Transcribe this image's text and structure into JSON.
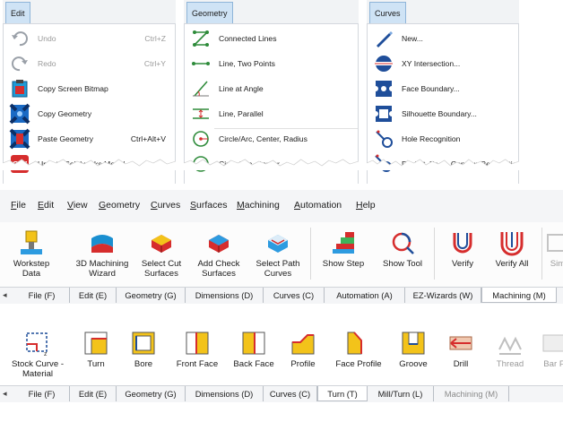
{
  "menus": [
    {
      "tab": "Edit",
      "items": [
        {
          "label": "Undo",
          "shortcut": "Ctrl+Z",
          "disabled": true,
          "icon": "undo-icon"
        },
        {
          "label": "Redo",
          "shortcut": "Ctrl+Y",
          "disabled": true,
          "icon": "redo-icon"
        },
        {
          "label": "Copy Screen Bitmap",
          "shortcut": "",
          "disabled": false,
          "icon": "copy-screen-bitmap-icon"
        },
        {
          "label": "Copy Geometry",
          "shortcut": "",
          "disabled": false,
          "icon": "copy-geometry-icon"
        },
        {
          "label": "Paste Geometry",
          "shortcut": "Ctrl+Alt+V",
          "disabled": false,
          "icon": "paste-geometry-icon"
        },
        {
          "label": "Update Solidworks Model",
          "shortcut": "",
          "disabled": false,
          "icon": "solidworks-icon"
        }
      ]
    },
    {
      "tab": "Geometry",
      "items": [
        {
          "label": "Connected Lines",
          "icon": "connected-lines-icon"
        },
        {
          "label": "Line, Two Points",
          "icon": "line-two-points-icon"
        },
        {
          "label": "Line at Angle",
          "icon": "line-at-angle-icon"
        },
        {
          "label": "Line, Parallel",
          "icon": "line-parallel-icon"
        },
        {
          "label": "Circle/Arc, Center, Radius",
          "icon": "circle-center-radius-icon"
        },
        {
          "label": "Circle/Arc, Center",
          "icon": "circle-center-icon"
        }
      ]
    },
    {
      "tab": "Curves",
      "items": [
        {
          "label": "New...",
          "icon": "new-curve-icon"
        },
        {
          "label": "XY Intersection...",
          "icon": "xy-intersection-icon"
        },
        {
          "label": "Face Boundary...",
          "icon": "face-boundary-icon"
        },
        {
          "label": "Silhouette Boundary...",
          "icon": "silhouette-boundary-icon"
        },
        {
          "label": "Hole Recognition",
          "icon": "hole-recognition-icon"
        },
        {
          "label": "Pocket, Face, Contour Recognition",
          "icon": "pocket-face-contour-icon"
        }
      ]
    }
  ],
  "menubar": [
    {
      "label": "File",
      "ul": "F"
    },
    {
      "label": "Edit",
      "ul": "E"
    },
    {
      "label": "View",
      "ul": "V"
    },
    {
      "label": "Geometry",
      "ul": "G"
    },
    {
      "label": "Curves",
      "ul": "C"
    },
    {
      "label": "Surfaces",
      "ul": "S"
    },
    {
      "label": "Machining",
      "ul": "M"
    },
    {
      "label": "Automation",
      "ul": "A"
    },
    {
      "label": "Help",
      "ul": "H"
    }
  ],
  "toolbar1": [
    {
      "label": "Workstep\nData",
      "icon": "workstep-data-icon"
    },
    {
      "label": "3D Machining\nWizard",
      "icon": "3d-machining-wizard-icon"
    },
    {
      "label": "Select Cut\nSurfaces",
      "icon": "select-cut-surfaces-icon"
    },
    {
      "label": "Add Check\nSurfaces",
      "icon": "add-check-surfaces-icon"
    },
    {
      "label": "Select Path\nCurves",
      "icon": "select-path-curves-icon"
    },
    {
      "label": "Show Step",
      "icon": "show-step-icon"
    },
    {
      "label": "Show Tool",
      "icon": "show-tool-icon"
    },
    {
      "label": "Verify",
      "icon": "verify-icon"
    },
    {
      "label": "Verify All",
      "icon": "verify-all-icon"
    },
    {
      "label": "Sim",
      "icon": "simulate-icon",
      "disabled": true
    }
  ],
  "tabs1": [
    {
      "label": "File (F)"
    },
    {
      "label": "Edit (E)"
    },
    {
      "label": "Geometry (G)"
    },
    {
      "label": "Dimensions (D)"
    },
    {
      "label": "Curves (C)"
    },
    {
      "label": "Automation (A)"
    },
    {
      "label": "EZ-Wizards (W)"
    },
    {
      "label": "Machining (M)",
      "active": true
    }
  ],
  "toolbar2": [
    {
      "label": "Stock Curve -\nMaterial",
      "icon": "stock-curve-material-icon"
    },
    {
      "label": "Turn",
      "icon": "turn-icon"
    },
    {
      "label": "Bore",
      "icon": "bore-icon"
    },
    {
      "label": "Front Face",
      "icon": "front-face-icon"
    },
    {
      "label": "Back Face",
      "icon": "back-face-icon"
    },
    {
      "label": "Profile",
      "icon": "profile-icon"
    },
    {
      "label": "Face Profile",
      "icon": "face-profile-icon"
    },
    {
      "label": "Groove",
      "icon": "groove-icon"
    },
    {
      "label": "Drill",
      "icon": "drill-icon"
    },
    {
      "label": "Thread",
      "icon": "thread-icon",
      "disabled": true
    },
    {
      "label": "Bar F",
      "icon": "bar-feed-icon",
      "disabled": true
    }
  ],
  "tabs2": [
    {
      "label": "File (F)"
    },
    {
      "label": "Edit (E)"
    },
    {
      "label": "Geometry (G)"
    },
    {
      "label": "Dimensions (D)"
    },
    {
      "label": "Curves (C)"
    },
    {
      "label": "Turn (T)",
      "active": true
    },
    {
      "label": "Mill/Turn (L)"
    },
    {
      "label": "Machining (M)",
      "faded": true
    }
  ],
  "colors": {
    "accent_blue": "#1f4e9a",
    "accent_red": "#d62d2d",
    "menu_tab": "#cfe3f5"
  }
}
